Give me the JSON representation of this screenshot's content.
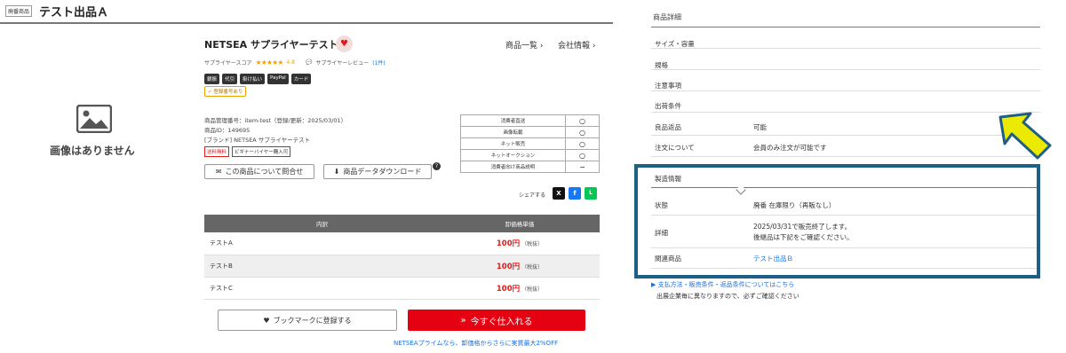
{
  "header": {
    "badge": "廃番商品",
    "title": "テスト出品Ａ"
  },
  "no_image": {
    "text": "画像はありません",
    "icon": "image-placeholder-icon"
  },
  "supplier": {
    "name": "NETSEA サプライヤーテスト",
    "links": {
      "products": "商品一覧",
      "company": "会社情報"
    },
    "score_label": "サプライヤースコア",
    "stars": "★★★★★",
    "score": "4.8",
    "review_label": "サプライヤーレビュー",
    "review_count": "(1件)",
    "payment_chips": [
      "銀振",
      "代引",
      "掛け払い",
      "PayPal",
      "カード"
    ],
    "registration_chip": "✓ 登録番号あり"
  },
  "product_meta": {
    "management_no": "商品管理番号：item-test（登録/更新：2025/03/01）",
    "product_id": "商品ID：149695",
    "brand": "[ブランド] NETSEA サプライヤーテスト",
    "tags": [
      "送料無料",
      "ビギナーバイヤー購入可"
    ]
  },
  "actions": {
    "inquiry": "この商品について問合せ",
    "download": "商品データダウンロード",
    "help": "?"
  },
  "availability": [
    {
      "label": "消費者直送",
      "value": "○"
    },
    {
      "label": "画像転載",
      "value": "○"
    },
    {
      "label": "ネット販売",
      "value": "○"
    },
    {
      "label": "ネットオークション",
      "value": "○"
    },
    {
      "label": "消費者向け商品説明",
      "value": "−"
    }
  ],
  "share": {
    "label": "シェアする",
    "x": "X",
    "facebook": "f",
    "line": "L"
  },
  "price_table": {
    "headers": [
      "内訳",
      "卸価格単価"
    ],
    "rows": [
      {
        "name": "テストA",
        "price": "100円",
        "tax": "（税抜）"
      },
      {
        "name": "テストB",
        "price": "100円",
        "tax": "（税抜）"
      },
      {
        "name": "テストC",
        "price": "100円",
        "tax": "（税抜）"
      }
    ]
  },
  "cta": {
    "bookmark": "ブックマークに登録する",
    "buy": "今すぐ仕入れる",
    "prime_note": "NETSEAプライムなら、卸価格からさらに実質最大2%OFF"
  },
  "details": {
    "heading": "商品詳細",
    "rows": [
      {
        "label": "サイズ・容量",
        "value": ""
      },
      {
        "label": "規格",
        "value": ""
      },
      {
        "label": "注意事項",
        "value": ""
      },
      {
        "label": "出荷条件",
        "value": ""
      },
      {
        "label": "良品返品",
        "value": "可能"
      },
      {
        "label": "注文について",
        "value": "会員のみ注文が可能です"
      }
    ]
  },
  "manufacturing": {
    "heading": "製造情報",
    "status_label": "状態",
    "status_value": "廃番 在庫限り（再販なし）",
    "detail_label": "詳細",
    "detail_line1": "2025/03/31で販売終了します。",
    "detail_line2": "後継品は下記をご確認ください。",
    "related_label": "関連商品",
    "related_value": "テスト出品Ｂ"
  },
  "footer_note": {
    "link": "▶ 支払方法・販売条件・返品条件についてはこちら",
    "text": "出展企業毎に異なりますので、必ずご確認ください"
  },
  "colors": {
    "accent_red": "#e50012",
    "highlight": "#1e5f86",
    "arrow": "#ecea00",
    "link": "#1a6fe2"
  }
}
